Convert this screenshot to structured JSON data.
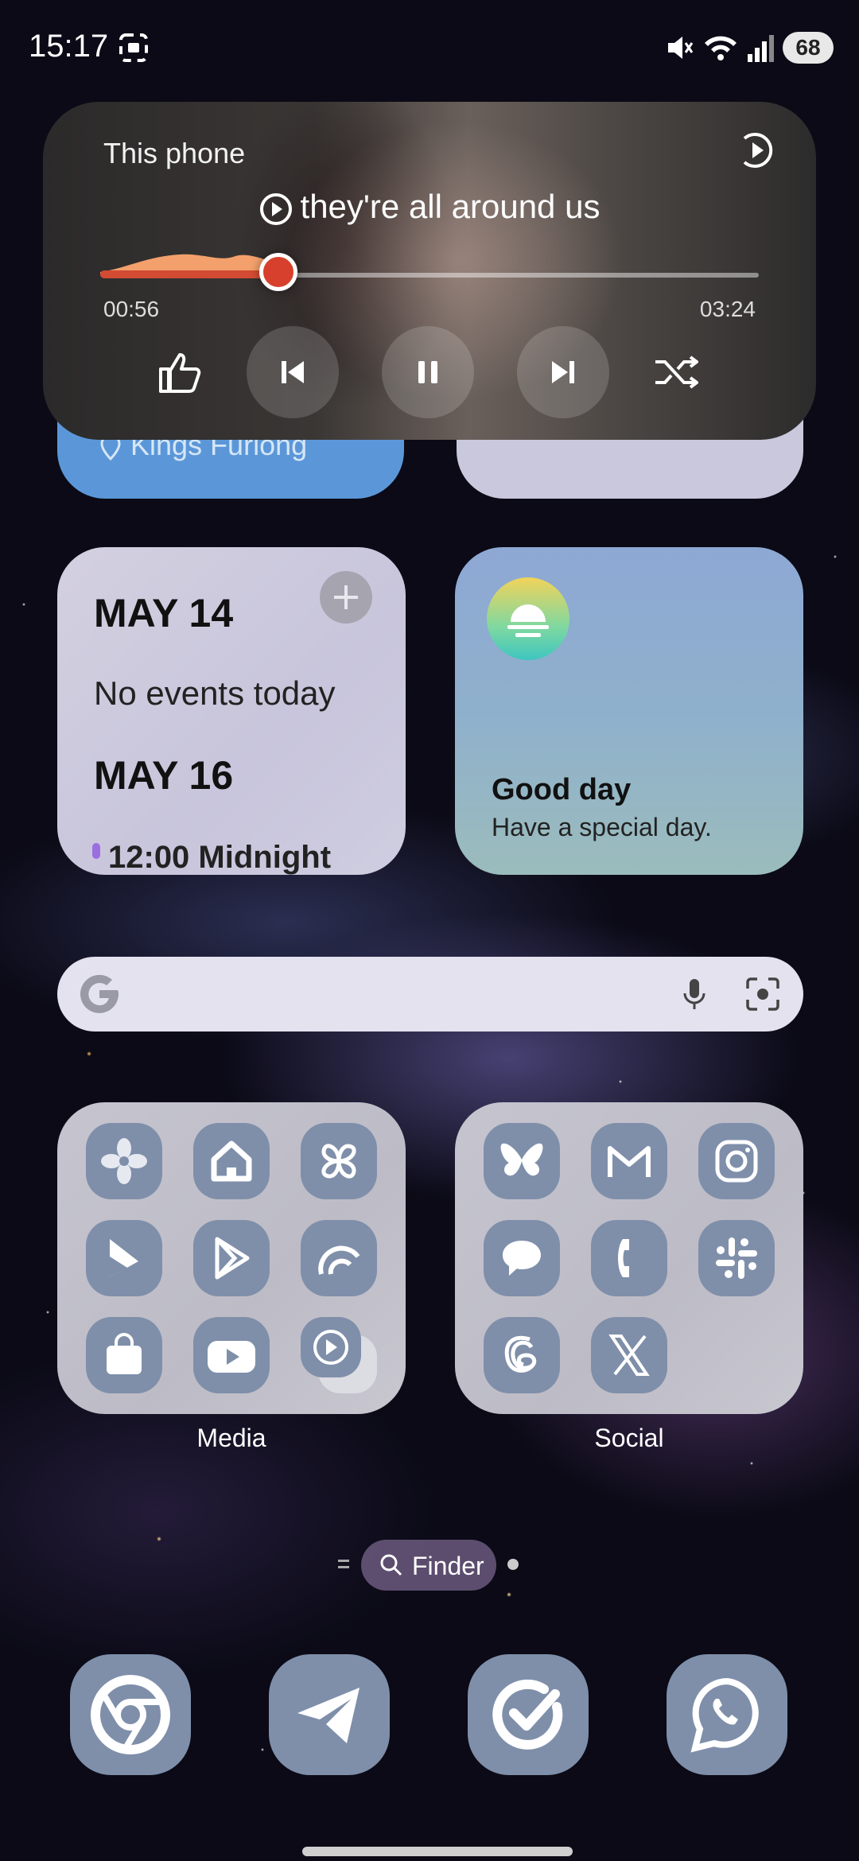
{
  "status_bar": {
    "time": "15:17",
    "battery": "68",
    "icons": [
      "screenshot-icon",
      "mute-icon",
      "wifi-icon",
      "signal-icon"
    ]
  },
  "media_player": {
    "source": "This phone",
    "track_title": "they're all around us",
    "current_time": "00:56",
    "duration": "03:24",
    "progress": 0.27,
    "accent": "#d24b32",
    "controls": [
      "thumbs-up-icon",
      "previous-icon",
      "pause-icon",
      "next-icon",
      "shuffle-icon"
    ]
  },
  "location_widget": {
    "text": "Kings Furlong"
  },
  "calendar_widget": {
    "date1": "MAY 14",
    "no_events": "No events today",
    "date2": "MAY 16",
    "event_partial": "12:00 Midnight"
  },
  "weather_widget": {
    "title": "Good day",
    "subtitle": "Have a special day."
  },
  "search_bar": {
    "icons": [
      "google-logo",
      "mic-icon",
      "lens-icon"
    ]
  },
  "folders": [
    {
      "label": "Media",
      "apps": [
        "gallery-icon",
        "smartthings-icon",
        "pinwheel-icon",
        "bandlab-icon",
        "play-store-icon",
        "arc-icon",
        "galaxy-store-icon",
        "youtube-icon",
        "youtube-music-icon"
      ]
    },
    {
      "label": "Social",
      "apps": [
        "bluesky-icon",
        "gmail-icon",
        "instagram-icon",
        "messages-icon",
        "phone-icon",
        "slack-icon",
        "threads-icon",
        "x-icon"
      ]
    }
  ],
  "finder": {
    "label": "Finder"
  },
  "dock": {
    "apps": [
      "chrome-icon",
      "telegram-icon",
      "tasks-icon",
      "whatsapp-icon"
    ]
  }
}
